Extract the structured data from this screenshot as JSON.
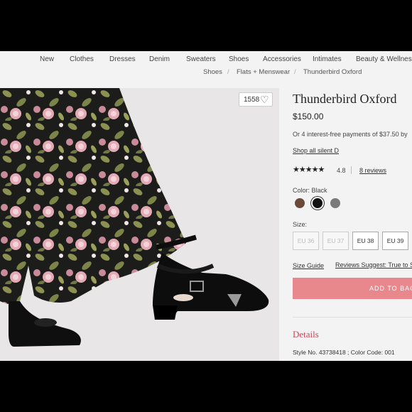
{
  "nav": {
    "items": [
      "New",
      "Clothes",
      "Dresses",
      "Denim",
      "Sweaters",
      "Shoes",
      "Accessories",
      "Intimates",
      "Beauty & Wellness"
    ]
  },
  "breadcrumb": {
    "items": [
      "Shoes",
      "Flats + Menswear",
      "Thunderbird Oxford"
    ],
    "separator": "/"
  },
  "photo": {
    "likes": "1558"
  },
  "product": {
    "title": "Thunderbird Oxford",
    "price": "$150.00",
    "installments": "Or 4 interest-free payments of $37.50 by",
    "shop_all": "Shop all silent D",
    "stars": "★★★★★",
    "rating": "4.8",
    "reviews": "8 reviews",
    "color_label": "Color: Black",
    "swatches": [
      "#6b4a3a",
      "#111111",
      "#7a7a7a"
    ],
    "size_label": "Size:",
    "sizes": [
      {
        "label": "EU 36",
        "available": false
      },
      {
        "label": "EU 37",
        "available": false
      },
      {
        "label": "EU 38",
        "available": true
      },
      {
        "label": "EU 39",
        "available": true
      }
    ],
    "size_guide": "Size Guide",
    "reviews_suggest": "Reviews Suggest: True to Siz",
    "add_to_bag": "ADD TO BAG",
    "details_heading": "Details",
    "style_info": "Style No. 43738418 ; Color Code: 001"
  }
}
